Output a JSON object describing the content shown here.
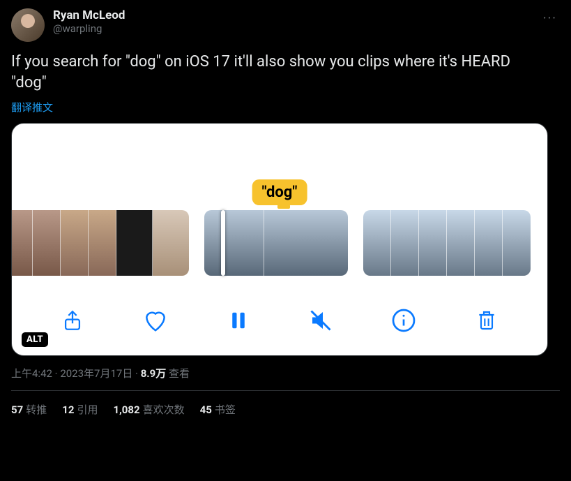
{
  "author": {
    "display_name": "Ryan McLeod",
    "handle": "@warpling"
  },
  "text": "If you search for \"dog\" on iOS 17 it'll also show you clips where it's HEARD \"dog\"",
  "translate_label": "翻译推文",
  "media": {
    "tooltip": "\"dog\"",
    "alt_badge": "ALT"
  },
  "meta": {
    "time": "上午4:42",
    "sep": " · ",
    "date": "2023年7月17日",
    "views_value": "8.9万",
    "views_label": " 查看"
  },
  "stats": {
    "retweets": {
      "value": "57",
      "label": "转推"
    },
    "quotes": {
      "value": "12",
      "label": "引用"
    },
    "likes": {
      "value": "1,082",
      "label": "喜欢次数"
    },
    "bookmarks": {
      "value": "45",
      "label": "书签"
    }
  },
  "icons": {
    "more": "···"
  }
}
